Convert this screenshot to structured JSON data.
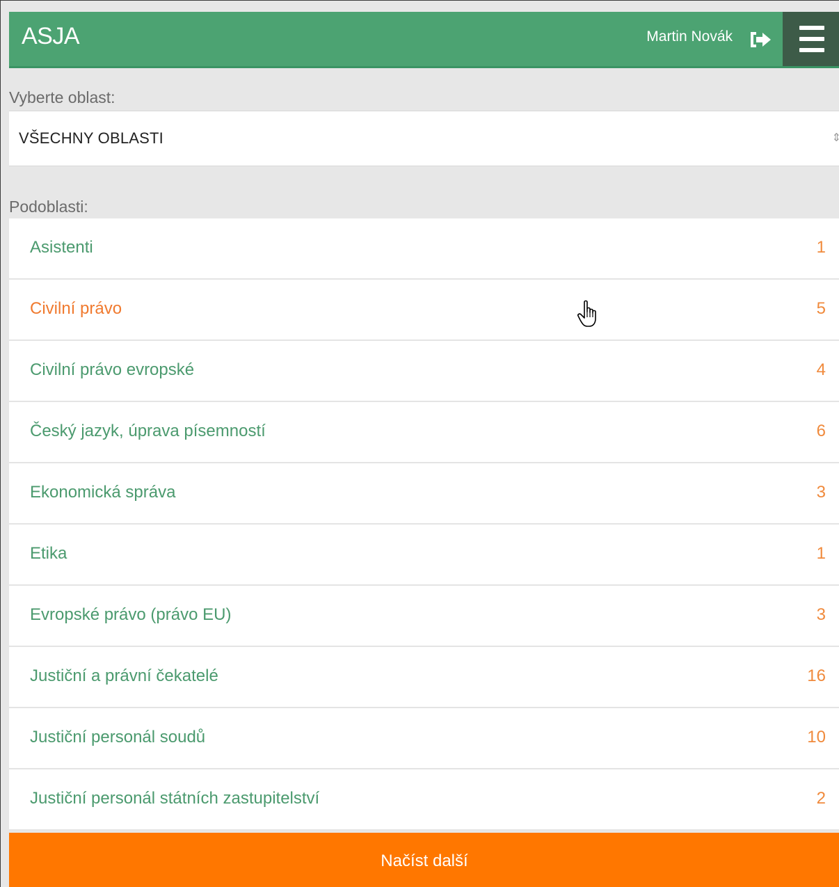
{
  "header": {
    "brand": "ASJA",
    "user_name": "Martin Novák",
    "logout_icon": "logout-icon",
    "menu_icon": "hamburger-menu-icon"
  },
  "area_select": {
    "label": "Vyberte oblast:",
    "value": "VŠECHNY OBLASTI"
  },
  "subareas": {
    "label": "Podoblasti:",
    "items": [
      {
        "name": "Asistenti",
        "count": "1"
      },
      {
        "name": "Civilní právo",
        "count": "5",
        "active": true
      },
      {
        "name": "Civilní právo evropské",
        "count": "4"
      },
      {
        "name": "Český jazyk, úprava písemností",
        "count": "6"
      },
      {
        "name": "Ekonomická správa",
        "count": "3"
      },
      {
        "name": "Etika",
        "count": "1"
      },
      {
        "name": "Evropské právo (právo EU)",
        "count": "3"
      },
      {
        "name": "Justiční a právní čekatelé",
        "count": "16"
      },
      {
        "name": "Justiční personál soudů",
        "count": "10"
      },
      {
        "name": "Justiční personál státních zastupitelství",
        "count": "2"
      }
    ]
  },
  "load_more_label": "Načíst další",
  "colors": {
    "header_green": "#4ca372",
    "menu_dark": "#3d5b48",
    "link_green": "#4b9a6e",
    "accent_orange": "#ff7700",
    "count_orange": "#f08a3c"
  }
}
